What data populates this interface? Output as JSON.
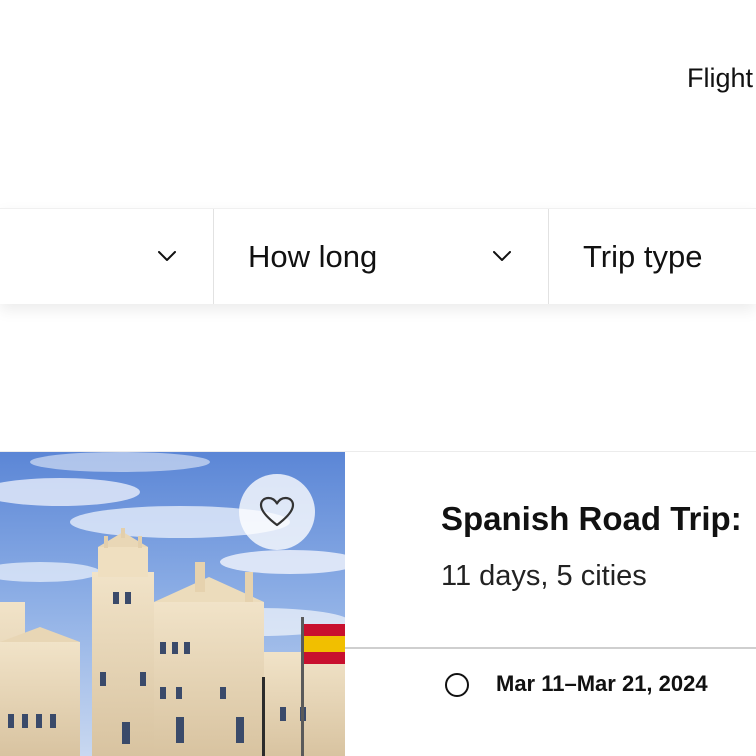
{
  "top_nav": {
    "flights_label": "Flight"
  },
  "filters": [
    {
      "label": ""
    },
    {
      "label": "How long"
    },
    {
      "label": "Trip type"
    }
  ],
  "trip_card": {
    "title": "Spanish Road Trip:",
    "subtitle": "11 days, 5 cities",
    "date_option": "Mar 11–Mar 21, 2024",
    "image_icon": "madrid-palace-photo",
    "favorite_icon": "heart-icon"
  },
  "colors": {
    "text": "#111111",
    "divider": "#e2e2e2",
    "background": "#ffffff"
  }
}
